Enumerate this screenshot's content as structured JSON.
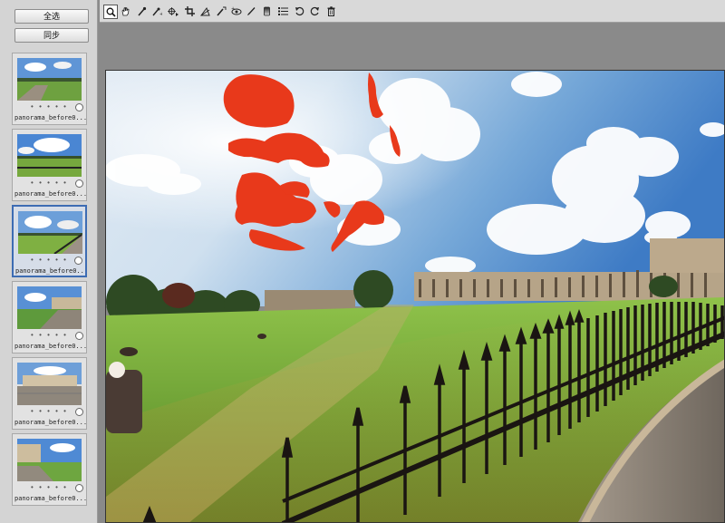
{
  "sidebar": {
    "select_all_label": "全选",
    "sync_label": "同步",
    "thumbnails": [
      {
        "name": "panorama_before0...",
        "dots": "• • • • •",
        "selected": false
      },
      {
        "name": "panorama_before0...",
        "dots": "• • • • •",
        "selected": false
      },
      {
        "name": "panorama_before0...",
        "dots": "• • • • •",
        "selected": true
      },
      {
        "name": "panorama_before0...",
        "dots": "• • • • •",
        "selected": false
      },
      {
        "name": "panorama_before0...",
        "dots": "• • • • •",
        "selected": false
      },
      {
        "name": "panorama_before0...",
        "dots": "• • • • •",
        "selected": false
      }
    ]
  },
  "toolbar": {
    "tools": [
      {
        "icon": "zoom-icon",
        "active": true
      },
      {
        "icon": "hand-icon"
      },
      {
        "icon": "white-balance-icon"
      },
      {
        "icon": "color-sampler-icon"
      },
      {
        "icon": "targeted-adjustment-icon"
      },
      {
        "icon": "crop-icon"
      },
      {
        "icon": "straighten-icon"
      },
      {
        "icon": "spot-removal-icon"
      },
      {
        "icon": "red-eye-icon"
      },
      {
        "icon": "adjustment-brush-icon"
      },
      {
        "icon": "graduated-filter-icon"
      },
      {
        "icon": "preferences-icon"
      },
      {
        "icon": "rotate-left-icon"
      },
      {
        "icon": "rotate-right-icon"
      },
      {
        "icon": "trash-icon"
      }
    ]
  },
  "colors": {
    "accent": "#3d6cb3",
    "mask_overlay": "#e8391b",
    "panel": "#d4d4d4",
    "workspace": "#8a8a8a"
  }
}
